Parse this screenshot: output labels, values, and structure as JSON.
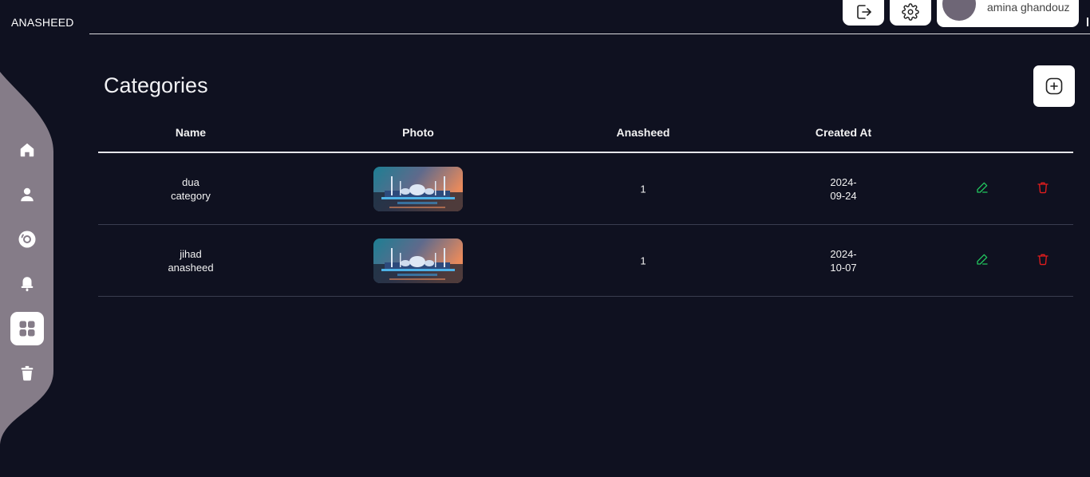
{
  "app": {
    "brand": "ANASHEED"
  },
  "topbar": {
    "logout_icon": "logout-icon",
    "settings_icon": "gear-icon",
    "user_name": "amina ghandouz"
  },
  "sidebar": {
    "items": [
      {
        "name": "home",
        "icon": "home-icon",
        "active": false
      },
      {
        "name": "users",
        "icon": "user-icon",
        "active": false
      },
      {
        "name": "albums",
        "icon": "disc-icon",
        "active": false
      },
      {
        "name": "notifications",
        "icon": "bell-icon",
        "active": false
      },
      {
        "name": "categories",
        "icon": "grid-icon",
        "active": true
      },
      {
        "name": "trash",
        "icon": "trash-icon",
        "active": false
      }
    ]
  },
  "page": {
    "title": "Categories",
    "add_icon": "plus-square-icon"
  },
  "table": {
    "headers": [
      "Name",
      "Photo",
      "Anasheed",
      "Created At"
    ],
    "rows": [
      {
        "name_line1": "dua",
        "name_line2": "category",
        "anasheed": "1",
        "date_line1": "2024-",
        "date_line2": "09-24"
      },
      {
        "name_line1": "jihad",
        "name_line2": "anasheed",
        "anasheed": "1",
        "date_line1": "2024-",
        "date_line2": "10-07"
      }
    ],
    "edit_icon": "pencil-icon",
    "delete_icon": "trash-icon"
  },
  "colors": {
    "background": "#0f1120",
    "sidebar": "#857c88",
    "edit": "#22c55e",
    "delete": "#e11d1d"
  }
}
